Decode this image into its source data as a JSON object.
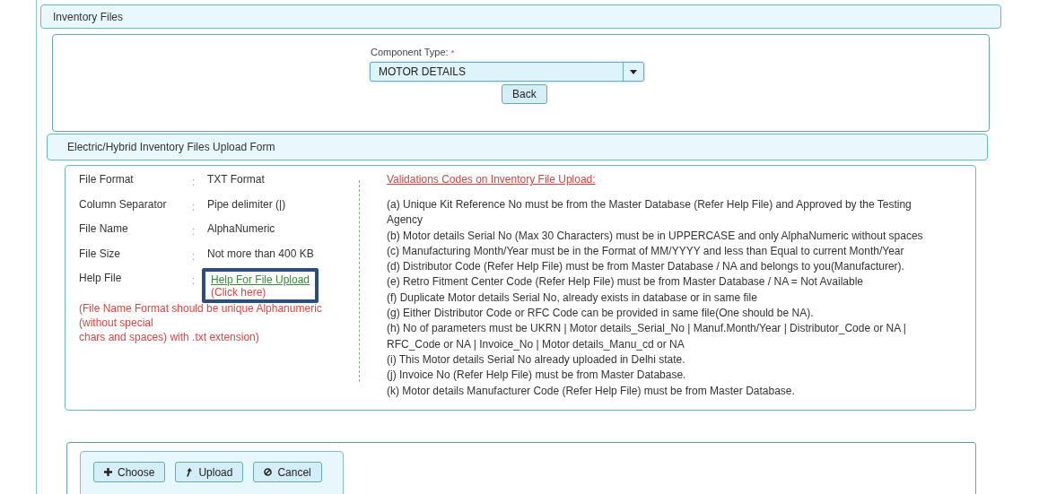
{
  "panel": {
    "title": "Inventory Files"
  },
  "component_type": {
    "label": "Component Type:",
    "required_mark": "*",
    "value": "MOTOR DETAILS"
  },
  "back_button": "Back",
  "form": {
    "title": "Electric/Hybrid Inventory Files Upload Form",
    "specs": [
      {
        "label": "File Format",
        "separator": ":",
        "value": "TXT Format",
        "kind": "text"
      },
      {
        "label": "Column Separator",
        "separator": ":",
        "value": "Pipe delimiter (|)",
        "kind": "text"
      },
      {
        "label": "File Name",
        "separator": ":",
        "value": "AlphaNumeric",
        "kind": "text"
      },
      {
        "label": "File Size",
        "separator": ":",
        "value": "Not more than 400 KB",
        "kind": "text"
      },
      {
        "label": "Help File",
        "separator": ":",
        "value": "Help For File Upload",
        "hint": "(Click here)",
        "kind": "link",
        "highlighted": true
      }
    ],
    "note_lines": [
      "(File Name Format should be unique Alphanumeric",
      "(without special",
      "chars and spaces) with .txt extension)"
    ],
    "validations_title": "Validations Codes on Inventory File Upload:",
    "validations": [
      "(a) Unique Kit Reference No must be from the Master Database (Refer Help File) and Approved by the Testing Agency",
      "(b) Motor details Serial No (Max 30 Characters) must be in UPPERCASE and only AlphaNumeric without spaces",
      "(c) Manufacturing Month/Year must be in the Format of MM/YYYY and less than Equal to current Month/Year",
      "(d) Distributor Code (Refer Help File) must be from Master Database / NA and belongs to you(Manufacturer).",
      "(e) Retro Fitment Center Code (Refer Help File) must be from Master Database / NA = Not Available",
      "(f) Duplicate Motor details Serial No, already exists in database or in same file",
      "(g) Either Distributor Code or RFC Code can be provided in same file(One should be NA).",
      "(h) No of parameters must be UKRN | Motor details_Serial_No | Manuf.Month/Year | Distributor_Code or NA | RFC_Code or NA | Invoice_No | Motor details_Manu_cd or NA",
      "(i) This Motor details Serial No already uploaded in Delhi state.",
      "(j) Invoice No (Refer Help File) must be from Master Database.",
      "(k) Motor details Manufacturer Code (Refer Help File) must be from Master Database."
    ]
  },
  "upload_buttons": [
    {
      "label": "Choose",
      "kind": "add"
    },
    {
      "label": "Upload",
      "kind": "upload"
    },
    {
      "label": "Cancel",
      "kind": "cancel"
    }
  ]
}
